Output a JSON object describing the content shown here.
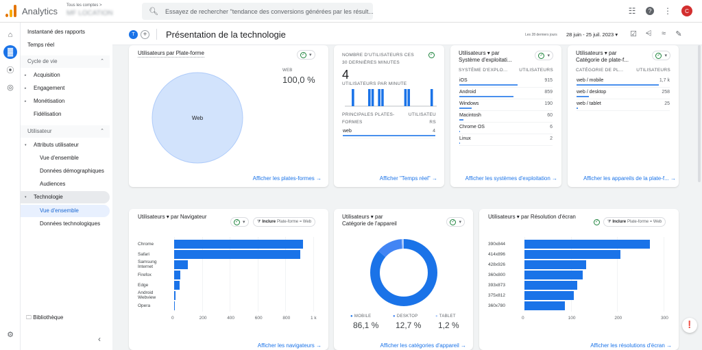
{
  "topbar": {
    "app_name": "Analytics",
    "account_label": "Tous les comptes >",
    "property_name": "MF LOCATION",
    "search_placeholder": "Essayez de rechercher \"tendance des conversions générées par les résult...",
    "avatar_text": "C"
  },
  "nav": {
    "items": [
      {
        "label": "Instantané des rapports"
      },
      {
        "label": "Temps réel"
      },
      {
        "label": "Cycle de vie"
      },
      {
        "label": "Acquisition"
      },
      {
        "label": "Engagement"
      },
      {
        "label": "Monétisation"
      },
      {
        "label": "Fidélisation"
      },
      {
        "label": "Utilisateur"
      },
      {
        "label": "Attributs utilisateur"
      },
      {
        "label": "Vue d'ensemble"
      },
      {
        "label": "Données démographiques"
      },
      {
        "label": "Audiences"
      },
      {
        "label": "Technologie"
      },
      {
        "label": "Vue d'ensemble"
      },
      {
        "label": "Données technologiques"
      }
    ],
    "library": "Bibliothèque"
  },
  "header": {
    "badge": "T",
    "title": "Présentation de la technologie",
    "date_label": "Les 28 derniers jours",
    "date_range": "28 juin - 25 juil. 2023"
  },
  "cards": {
    "platform": {
      "title": "Utilisateurs par Plate-forme",
      "slice_label": "Web",
      "legend_label": "WEB",
      "legend_value": "100,0 %",
      "link": "Afficher les plates-formes"
    },
    "realtime": {
      "title_line1": "NOMBRE D'UTILISATEURS CES",
      "title_line2": "30 DERNIÈRES MINUTES",
      "value": "4",
      "per_minute_label": "UTILISATEURS PAR MINUTE",
      "col1_line1": "PRINCIPALES PLATES-",
      "col1_line2": "FORMES",
      "col2_line1": "UTILISATEU",
      "col2_line2": "RS",
      "rows": [
        {
          "name": "web",
          "value": "4"
        }
      ],
      "minute_bars": [
        0,
        0,
        1,
        0,
        0,
        0,
        0,
        1,
        1,
        0,
        1,
        1,
        0,
        0,
        0,
        0,
        0,
        0,
        1,
        1,
        0,
        0,
        0,
        0,
        0,
        0,
        1,
        0
      ],
      "link": "Afficher \"Temps réel\""
    },
    "os": {
      "title_line1": "Utilisateurs ▾ par",
      "title_line2": "Système d'exploitati...",
      "col1": "SYSTÈME D'EXPLO...",
      "col2": "UTILISATEURS",
      "rows": [
        {
          "name": "iOS",
          "value": "915",
          "share": 0.915
        },
        {
          "name": "Android",
          "value": "859",
          "share": 0.859
        },
        {
          "name": "Windows",
          "value": "190",
          "share": 0.19
        },
        {
          "name": "Macintosh",
          "value": "60",
          "share": 0.06
        },
        {
          "name": "Chrome OS",
          "value": "6",
          "share": 0.006
        },
        {
          "name": "Linux",
          "value": "2",
          "share": 0.002
        }
      ],
      "link": "Afficher les systèmes d'exploitation"
    },
    "platform_device": {
      "title_line1": "Utilisateurs ▾ par",
      "title_line2": "Catégorie de plate-f...",
      "col1": "CATÉGORIE DE PL...",
      "col2": "UTILISATEURS",
      "rows": [
        {
          "name": "web / mobile",
          "value": "1,7 k",
          "share": 1.0
        },
        {
          "name": "web / desktop",
          "value": "258",
          "share": 0.15
        },
        {
          "name": "web / tablet",
          "value": "25",
          "share": 0.015
        }
      ],
      "link": "Afficher les appareils de la plate-f..."
    },
    "browser": {
      "title_metric": "Utilisateurs ▾",
      "title_dim": "par Navigateur",
      "filter_bold": "Inclure",
      "filter_text": "Plate-forme = Web",
      "link": "Afficher les navigateurs"
    },
    "device": {
      "title_line1": "Utilisateurs ▾ par",
      "title_line2": "Catégorie de l'appareil",
      "link": "Afficher les catégories d'appareil"
    },
    "resolution": {
      "title_metric": "Utilisateurs ▾",
      "title_dim": "par Résolution d'écran",
      "filter_bold": "Inclure",
      "filter_text": "Plate-forme = Web",
      "link": "Afficher les résolutions d'écran"
    }
  },
  "chart_data": [
    {
      "type": "pie",
      "title": "Utilisateurs par Plate-forme",
      "categories": [
        "Web"
      ],
      "values": [
        100.0
      ]
    },
    {
      "type": "bar",
      "title": "Utilisateurs par Navigateur",
      "categories": [
        "Chrome",
        "Safari",
        "Samsung Internet",
        "Firefox",
        "Edge",
        "Android Webview",
        "Opera"
      ],
      "values": [
        925,
        905,
        100,
        45,
        40,
        12,
        2
      ],
      "xticks": [
        "0",
        "200",
        "400",
        "600",
        "800",
        "1 k"
      ],
      "xlim": [
        0,
        1000
      ],
      "orientation": "horizontal"
    },
    {
      "type": "pie",
      "title": "Utilisateurs par Catégorie de l'appareil",
      "categories": [
        "MOBILE",
        "DESKTOP",
        "TABLET"
      ],
      "values": [
        86.1,
        12.7,
        1.2
      ],
      "labels": [
        "86,1 %",
        "12,7 %",
        "1,2 %"
      ],
      "colors": [
        "#1a73e8",
        "#4285f4",
        "#aecbfa"
      ],
      "donut": true
    },
    {
      "type": "bar",
      "title": "Utilisateurs par Résolution d'écran",
      "categories": [
        "390x844",
        "414x896",
        "428x926",
        "360x800",
        "393x873",
        "375x812",
        "360x780"
      ],
      "values": [
        270,
        207,
        133,
        125,
        114,
        107,
        87
      ],
      "xticks": [
        "0",
        "100",
        "200",
        "300"
      ],
      "xlim": [
        0,
        300
      ],
      "orientation": "horizontal"
    }
  ]
}
